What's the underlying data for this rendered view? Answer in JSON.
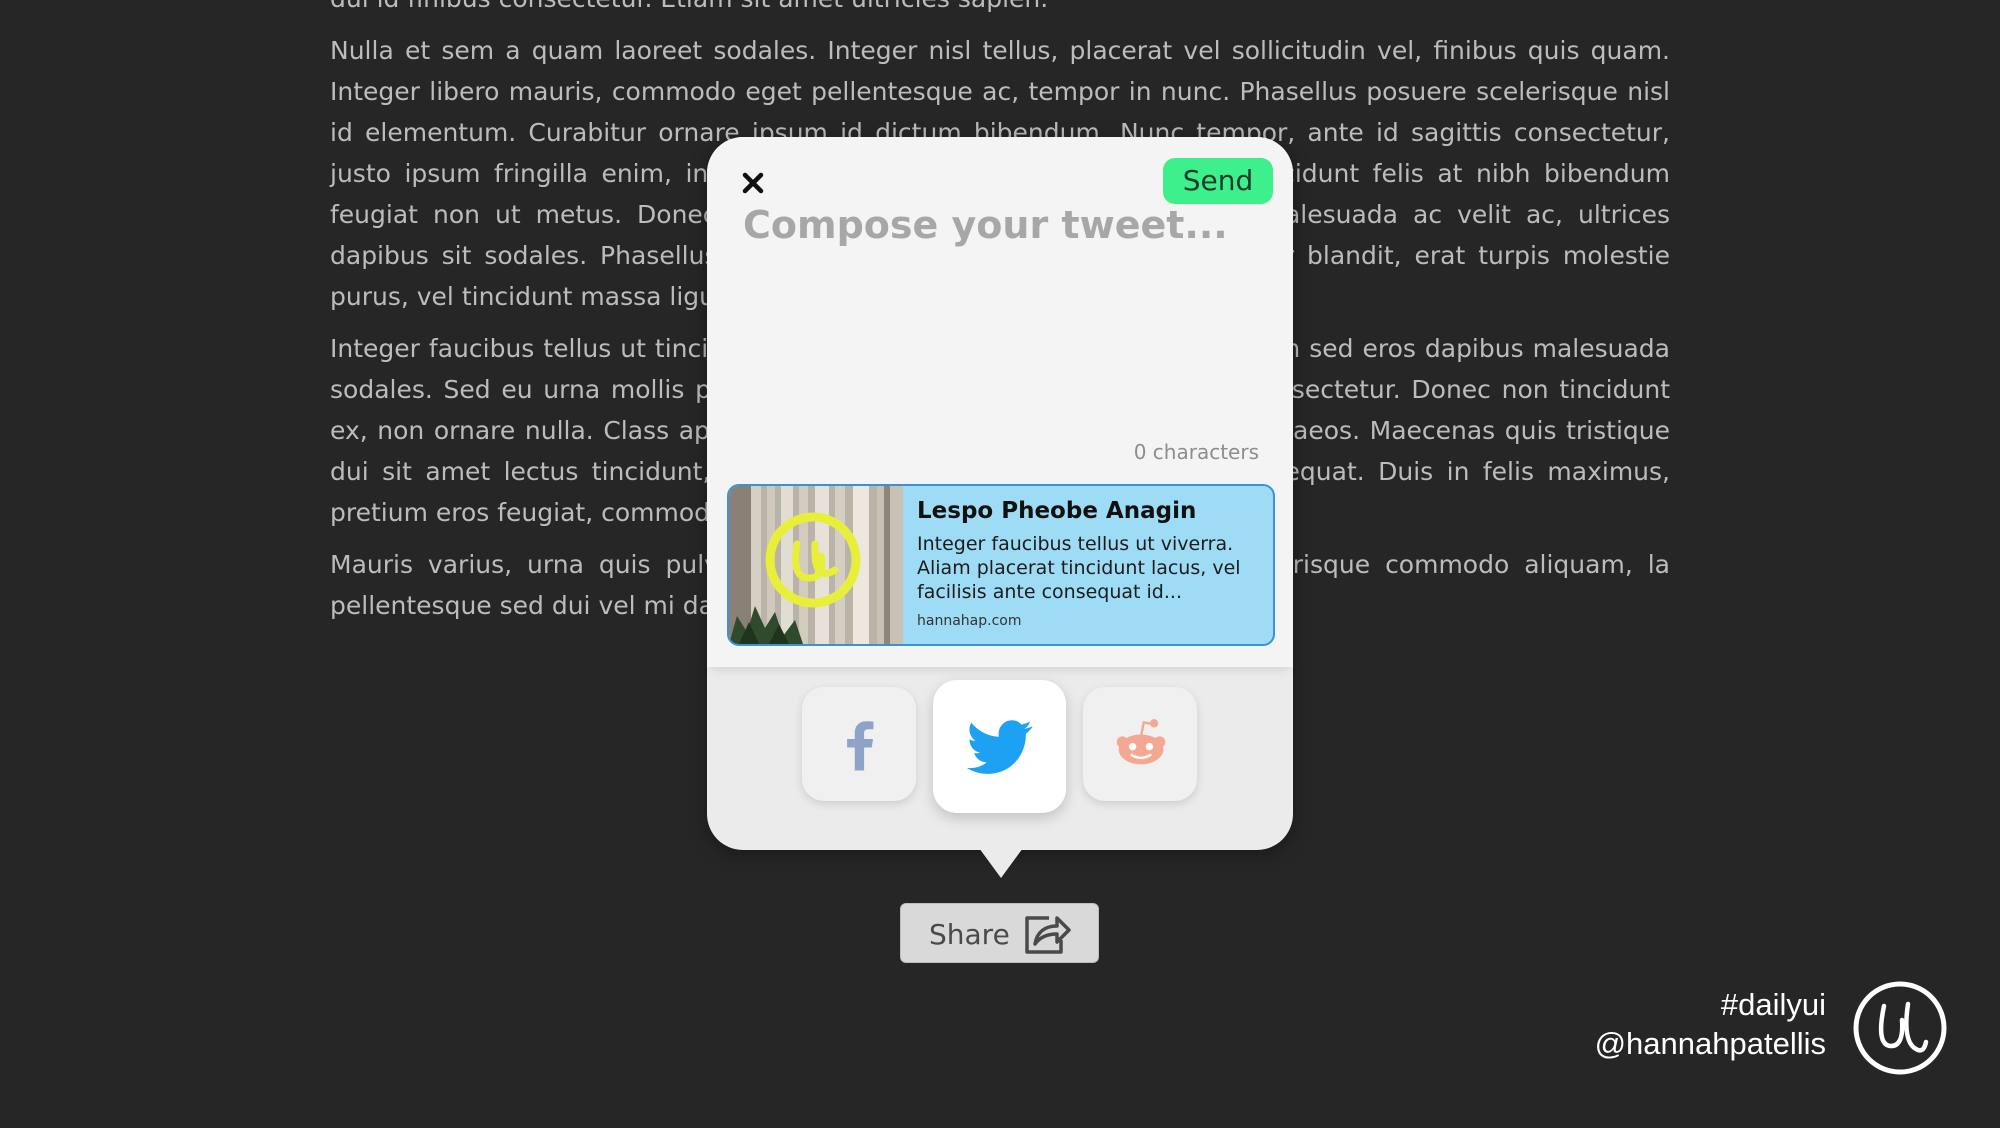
{
  "article": {
    "paragraphs": [
      "dui id finibus consectetur. Etiam sit amet ultricies sapien.",
      "Nulla et sem a quam laoreet sodales. Integer nisl tellus, placerat vel sollicitudin vel, finibus quis quam. Integer libero mauris, commodo eget pellentesque ac, tempor in nunc. Phasellus posuere scelerisque nisl id elementum. Curabitur ornare ipsum id dictum bibendum. Nunc tempor, ante id sagittis consectetur, justo ipsum fringilla enim, in sagittis nisi nibh convallis ligula. Ut eu tincidunt felis at nibh bibendum feugiat non ut metus. Donec eleifend faucibus ipsum. Ut nisi libero, malesuada ac velit ac, ultrices dapibus sit sodales. Phasellus molestie lacus nec orci tempor, id pulvinar blandit, erat turpis molestie purus, vel tincidunt massa ligula re nunc finibus at.",
      "Integer faucibus tellus ut tincidunt facilisis ante consequat id. Sed sed quam sed eros dapibus malesuada sodales. Sed eu urna mollis purus ornare pretium. In faucibus lacus et consectetur. Donec non tincidunt ex, non ornare nulla. Class aptent taciti conubia nostra, per inceptos himenaeos. Maecenas quis tristique dui sit amet lectus tincidunt, eu mollis arcu vulputate. Ut molestie consequat. Duis in felis maximus, pretium eros feugiat, commodo.",
      "Mauris varius, urna quis pulvinar metus a felis. Duis pulvinar, dui scelerisque commodo aliquam, la pellentesque sed dui vel mi dapi-"
    ]
  },
  "composer": {
    "send_label": "Send",
    "placeholder": "Compose your tweet...",
    "char_count": "0 characters"
  },
  "link_card": {
    "title": "Lespo Pheobe Anagin",
    "description": "Integer faucibus tellus ut viverra. Aliam placerat tincidunt lacus, vel facilisis ante consequat id...",
    "domain": "hannahap.com"
  },
  "share_buttons": [
    {
      "name": "facebook",
      "icon": "facebook-icon",
      "color": "#8fa2c8"
    },
    {
      "name": "twitter",
      "icon": "twitter-icon",
      "color": "#1da1f2"
    },
    {
      "name": "reddit",
      "icon": "reddit-icon",
      "color": "#f4a892"
    }
  ],
  "share_trigger": {
    "label": "Share",
    "icon": "share-icon"
  },
  "credit": {
    "tag": "#dailyui",
    "handle": "@hannahpatellis"
  },
  "colors": {
    "background": "#262626",
    "send_button": "#3df08c",
    "card": "#9edcf5",
    "card_border": "#3a93d6"
  }
}
